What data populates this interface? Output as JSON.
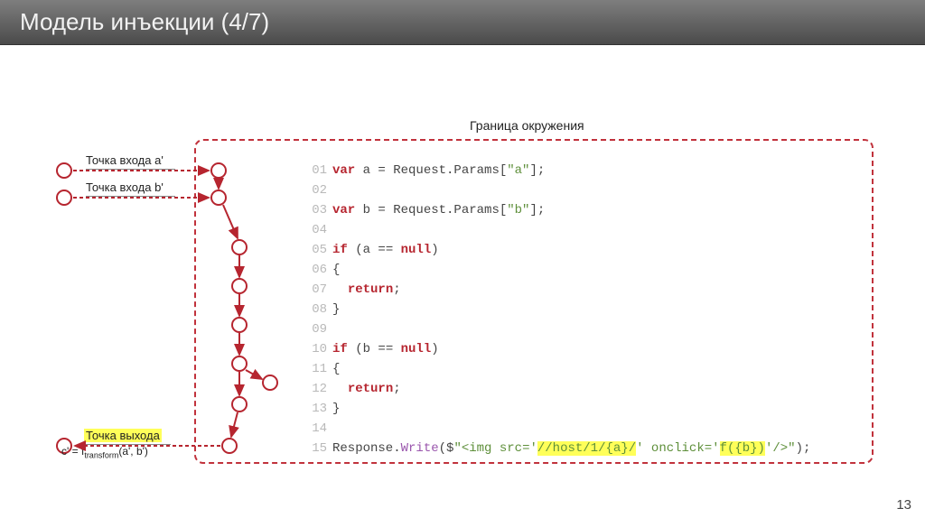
{
  "title": "Модель инъекции (4/7)",
  "boundary_label": "Граница окружения",
  "entry_a": "Точка входа a'",
  "entry_b": "Точка входа b'",
  "exit_point": "Точка выхода",
  "formula_pre": "c' = f",
  "formula_sub": "transform",
  "formula_post": "(a', b')",
  "page_number": "13",
  "code": {
    "kw_var": "var",
    "kw_if": "if",
    "kw_return": "return",
    "kw_null": "null",
    "l01_a": " a = Request.Params[",
    "l01_b": "\"a\"",
    "l01_c": "];",
    "l03_a": " b = Request.Params[",
    "l03_b": "\"b\"",
    "l03_c": "];",
    "l05_cond": " (a == ",
    "l05_close": ")",
    "l06": "{",
    "l07_ret": ";",
    "l08": "}",
    "l09": "",
    "l10_cond": " (b == ",
    "l10_close": ")",
    "l11": "{",
    "l13": "}",
    "l15_a": "Response.",
    "l15_write": "Write",
    "l15_open": "($",
    "l15_str1": "\"<img src='",
    "l15_h1": "//host/1/",
    "l15_h2": "{a}",
    "l15_h3": "/",
    "l15_str2": "' onclick='",
    "l15_h4": "f({b})",
    "l15_str3": "'/>\"",
    "l15_close": ");"
  }
}
